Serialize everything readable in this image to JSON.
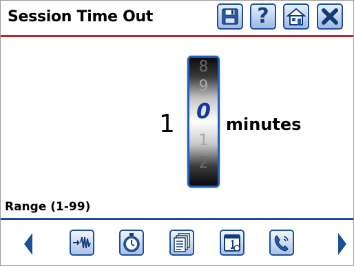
{
  "header": {
    "title": "Session Time Out",
    "buttons": [
      "save-icon",
      "help-icon",
      "home-icon",
      "close-icon"
    ],
    "help_glyph": "?"
  },
  "timeout": {
    "tens_digit": "1",
    "ones_roller": {
      "above2": "8",
      "above1": "9",
      "selected": "0",
      "below1": "1",
      "below2": "2"
    },
    "unit": "minutes"
  },
  "range_label": "Range (1-99)",
  "footer": {
    "icons": [
      "waveform-icon",
      "stopwatch-icon",
      "documents-icon",
      "calendar-icon",
      "phone-icon"
    ]
  },
  "colors": {
    "header_rule": "#c8202a",
    "footer_rule": "#1b4f9a",
    "accent": "#1d4f9a",
    "selected_digit": "#1236a6"
  }
}
